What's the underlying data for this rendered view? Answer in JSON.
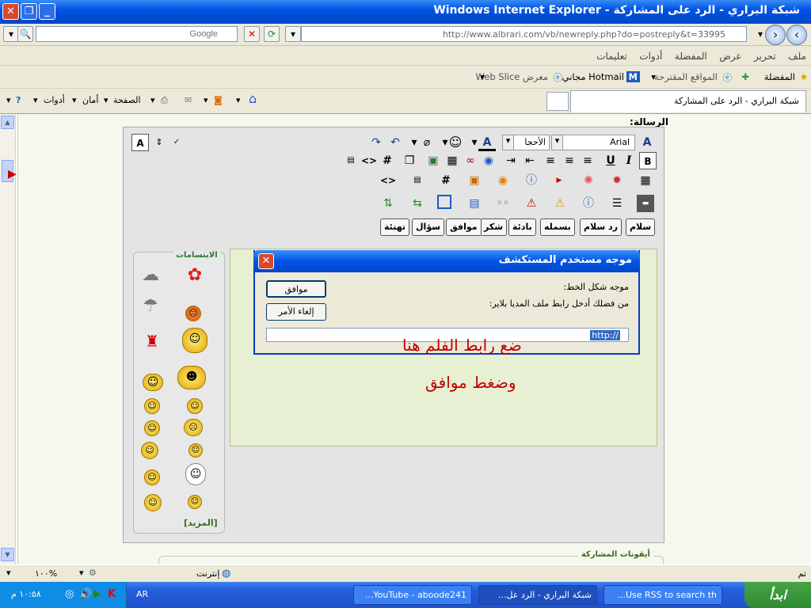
{
  "window": {
    "title": "شبكة البراري - الرد على المشاركة - Windows Internet Explorer"
  },
  "address": {
    "url": "http://www.albrari.com/vb/newreply.php?do=postreply&t=33995",
    "search_placeholder": "Google"
  },
  "menu": [
    "ملف",
    "تحرير",
    "عرض",
    "المفضلة",
    "أدوات",
    "تعليمات"
  ],
  "favbar": {
    "favorites": "المفضلة",
    "suggested": "المواقع المقترحة",
    "hotmail": "Hotmail مجاني",
    "webslice": "معرض Web Slice"
  },
  "tab": {
    "label": "شبكة البراري - الرد على المشاركة"
  },
  "commands": {
    "page": "الصفحة",
    "safety": "أمان",
    "tools": "أدوات"
  },
  "page": {
    "message_label": "الرسالة:"
  },
  "editor": {
    "font_name": "Arial",
    "font_size": "الأحجا",
    "tag_buttons": [
      "سلام",
      "رد سلام",
      "بسمله",
      "بادئة",
      "شكر",
      "موافق",
      "سؤال",
      "تهنئة"
    ],
    "smilies_title": "الابتسامات",
    "more_link": "[المزيد]"
  },
  "dialog": {
    "title": "موجه مستخدم المستكشف",
    "prompt_label": "موجه شكل الخط:",
    "prompt_text": "من فضلك أدخل رابط ملف المديا بلاير:",
    "ok_label": "موافق",
    "cancel_label": "إلغاء الأمر",
    "input_value": "http://"
  },
  "annotation": {
    "line1": "ضع رابط الفلم هنا",
    "line2": "وضغط موافق"
  },
  "post_icons": {
    "label": "أيقونات المشاركة"
  },
  "status": {
    "done": "تم",
    "zone": "إنترنت",
    "zoom": "١٠٠%"
  },
  "taskbar": {
    "start": "ابدأ",
    "items": [
      "Use RSS to search th...",
      "شبكة البراري - الرد عل...",
      "YouTube - aboode241..."
    ],
    "lang": "AR",
    "clock": "١٠:٥٨ م"
  },
  "colors": {
    "titlebar": "#0054e3",
    "annotation": "#c00000",
    "dialog_border": "#0040c8",
    "start": "#2f8a2f"
  }
}
